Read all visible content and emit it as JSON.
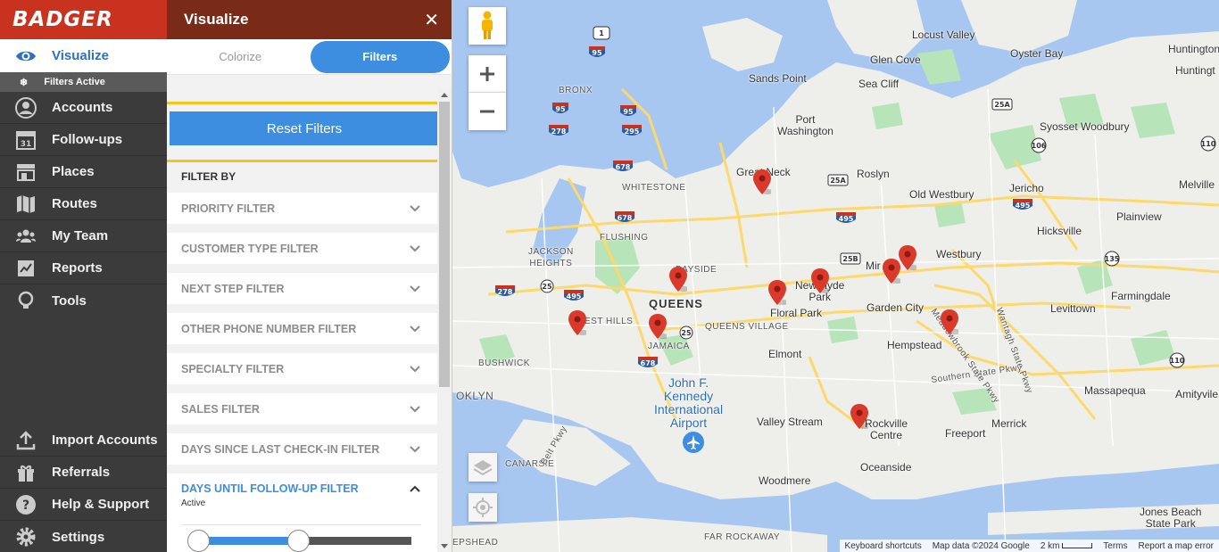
{
  "brand": {
    "name": "BADGER"
  },
  "sidebar": {
    "active": {
      "label": "Visualize",
      "sub_label": "Filters Active"
    },
    "items": [
      {
        "label": "Accounts",
        "icon": "person-icon"
      },
      {
        "label": "Follow-ups",
        "icon": "calendar-icon",
        "icon_text": "31"
      },
      {
        "label": "Places",
        "icon": "store-icon"
      },
      {
        "label": "Routes",
        "icon": "map-icon"
      },
      {
        "label": "My Team",
        "icon": "team-icon"
      },
      {
        "label": "Reports",
        "icon": "report-icon"
      },
      {
        "label": "Tools",
        "icon": "lightbulb-icon"
      }
    ],
    "bottom_items": [
      {
        "label": "Import Accounts",
        "icon": "upload-icon"
      },
      {
        "label": "Referrals",
        "icon": "gift-icon"
      },
      {
        "label": "Help & Support",
        "icon": "help-icon"
      },
      {
        "label": "Settings",
        "icon": "gear-icon"
      }
    ]
  },
  "panel": {
    "title": "Visualize",
    "close": "✕",
    "tabs": [
      {
        "label": "Colorize"
      },
      {
        "label": "Filters"
      }
    ],
    "reset_label": "Reset Filters",
    "filter_by": "FILTER BY",
    "filters": [
      "PRIORITY FILTER",
      "CUSTOMER TYPE FILTER",
      "NEXT STEP FILTER",
      "OTHER PHONE NUMBER FILTER",
      "SPECIALTY FILTER",
      "SALES FILTER",
      "DAYS SINCE LAST CHECK-IN FILTER"
    ],
    "open_filter": {
      "label": "DAYS UNTIL FOLLOW-UP FILTER",
      "status": "Active"
    }
  },
  "map": {
    "labels": {
      "locust_valley": "Locust Valley",
      "oyster_bay": "Oyster Bay",
      "huntington": "Huntington",
      "huntington2": "Huntingt",
      "glen_cove": "Glen Cove",
      "sands_point": "Sands Point",
      "sea_cliff": "Sea Cliff",
      "syosset": "Syosset Woodbury",
      "port_washington": "Port\nWashington",
      "great_neck": "Great Neck",
      "roslyn": "Roslyn",
      "old_westbury": "Old Westbury",
      "jericho": "Jericho",
      "melville": "Melville",
      "plainview": "Plainview",
      "hicksville": "Hicksville",
      "westbury": "Westbury",
      "mineola": "Mir",
      "new_hyde_park": "New Hyde\nPark",
      "garden_city": "Garden City",
      "hempstead": "Hempstead",
      "farmingdale": "Farmingdale",
      "levittown": "Levittown",
      "queens": "QUEENS",
      "floral_park": "Floral Park",
      "queens_village": "QUEENS VILLAGE",
      "jamaica": "JAMAICA",
      "forest_hills": "EST HILLS",
      "jackson_heights": "JACKSON\nHEIGHTS",
      "flushing": "FLUSHING",
      "bayside": "BAYSIDE",
      "whitestone": "WHITESTONE",
      "bronx": "BRONX",
      "bushwick": "BUSHWICK",
      "brooklyn": "OKLYN",
      "canarsie": "CANARSIE",
      "elmont": "Elmont",
      "jfk": "John F.\nKennedy\nInternational\nAirport",
      "valley_stream": "Valley Stream",
      "rockville": "Rockville\nCentre",
      "freeport": "Freeport",
      "merrick": "Merrick",
      "massapequa": "Massapequa",
      "amityville": "Amityvile",
      "oceanside": "Oceanside",
      "woodmere": "Woodmere",
      "jones_beach": "Jones Beach\nState Park",
      "far_rockaway": "FAR ROCKAWAY",
      "sheepshead": "EPSHEAD",
      "southern_pkwy": "Southern State Pkwy",
      "meadowbrook": "Meadowbrook State Pkwy",
      "wantagh": "Wantagh State Pkwy",
      "belt": "Belt Pkwy"
    },
    "shields": [
      "1",
      "95",
      "278",
      "295",
      "678",
      "495",
      "25A",
      "25",
      "25B",
      "106",
      "135",
      "110"
    ],
    "attribution": {
      "shortcuts": "Keyboard shortcuts",
      "data": "Map data ©2024 Google",
      "scale": "2 km",
      "terms": "Terms",
      "report": "Report a map error"
    },
    "colors": {
      "water": "#a8c7f0",
      "park": "#b7e4b9",
      "road": "#fdd96b",
      "pin": "#d93a2b"
    }
  }
}
